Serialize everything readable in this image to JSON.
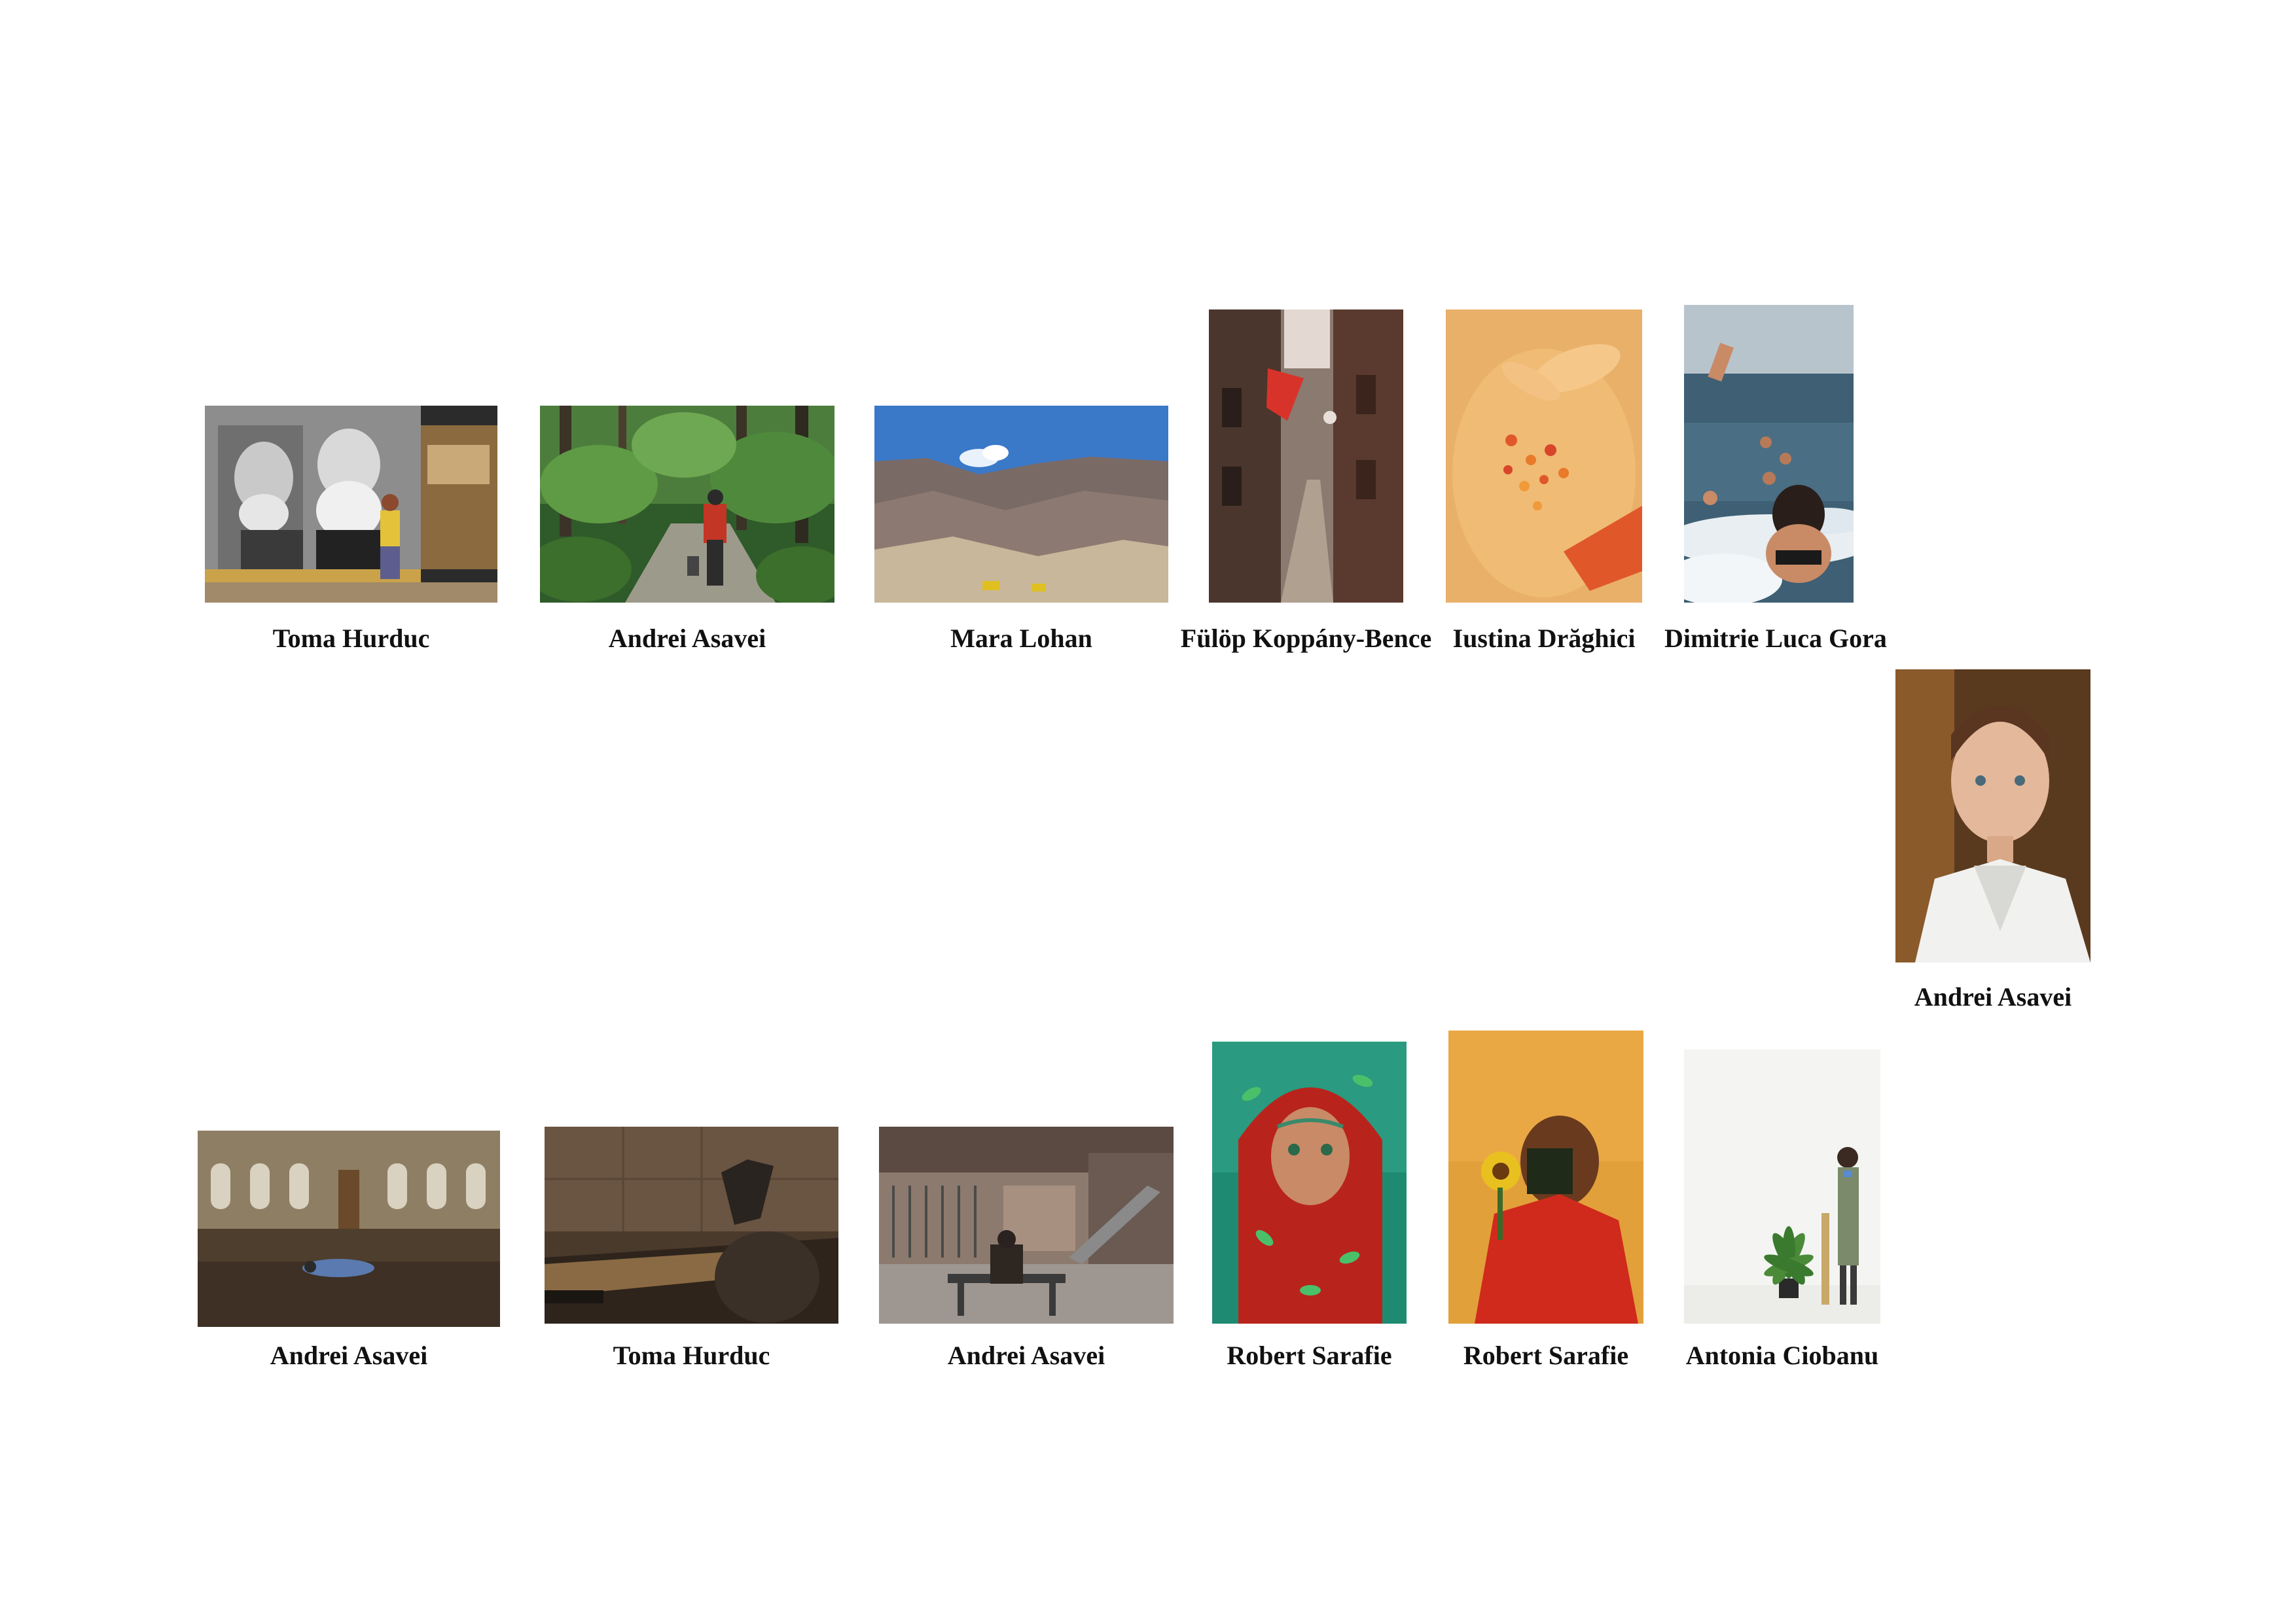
{
  "sheet": {
    "row1": [
      {
        "photographer": "Toma Hurduc",
        "subject": "elderly-men-mural-photo"
      },
      {
        "photographer": "Andrei Asavei",
        "subject": "forest-hiker-photo"
      },
      {
        "photographer": "Mara Lohan",
        "subject": "desert-mountains-photo"
      },
      {
        "photographer": "Fülöp Koppány-Bence",
        "subject": "narrow-street-photo"
      },
      {
        "photographer": "Iustina Drăghici",
        "subject": "body-flowers-photo"
      },
      {
        "photographer": "Dimitrie Luca Gora",
        "subject": "sea-swimmers-photo"
      }
    ],
    "side": {
      "photographer": "Andrei Asavei",
      "subject": "boy-portrait-photo"
    },
    "row2": [
      {
        "photographer": "Andrei Asavei",
        "subject": "mosque-interior-photo"
      },
      {
        "photographer": "Toma Hurduc",
        "subject": "shadowed-figure-photo"
      },
      {
        "photographer": "Andrei Asavei",
        "subject": "bench-courtyard-photo"
      },
      {
        "photographer": "Robert Sarafie",
        "subject": "red-scarf-portrait-photo"
      },
      {
        "photographer": "Robert Sarafie",
        "subject": "sunflower-portrait-photo"
      },
      {
        "photographer": "Antonia Ciobanu",
        "subject": "figure-with-plant-photo"
      }
    ]
  }
}
